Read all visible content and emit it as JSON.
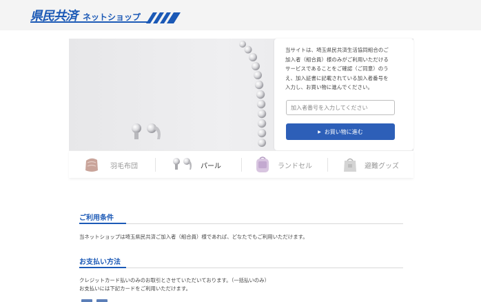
{
  "header": {
    "logo_main": "県民共済",
    "logo_sub": "ネットショップ"
  },
  "colors": {
    "brand_blue": "#1b59b6",
    "button_blue": "#2d5fb8",
    "header_bg": "#f4f4f4"
  },
  "hero": {
    "intro_lines": [
      "当サイトは、埼玉県民共済生活協同組合のご",
      "加入者（組合員）様のみがご利用いただける",
      "サービスであることをご確認（ご同意）のう",
      "え、加入証書に記載されている加入者番号を",
      "入力し、お買い物に進んでください。"
    ],
    "member_input_placeholder": "加入者番号を入力してください",
    "proceed_label": "お買い物に進む"
  },
  "categories": [
    {
      "label": "羽毛布団",
      "icon": "futon-icon",
      "active": false
    },
    {
      "label": "パール",
      "icon": "pearl-earring-icon",
      "active": true
    },
    {
      "label": "ランドセル",
      "icon": "randoseru-icon",
      "active": false
    },
    {
      "label": "避難グッズ",
      "icon": "emergency-bag-icon",
      "active": false
    }
  ],
  "sections": {
    "terms": {
      "title": "ご利用条件",
      "text": "当ネットショップは埼玉県民共済ご加入者（組合員）様であれば、どなたでもご利用いただけます。"
    },
    "payment": {
      "title": "お支払い方法",
      "lines": [
        "クレジットカード払いのみのお取引とさせていただいております。（一括払いのみ）",
        "お支払いには下記カードをご利用いただけます。"
      ]
    }
  }
}
